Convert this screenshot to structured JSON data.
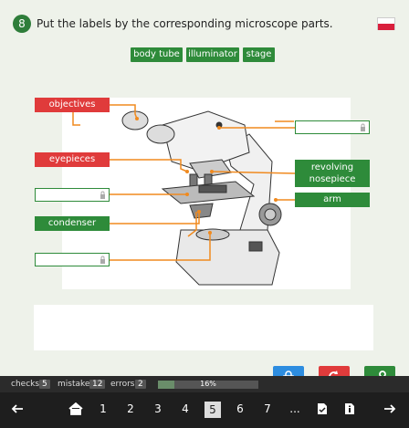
{
  "question": {
    "number": "8",
    "text": "Put the labels by the corresponding microscope parts."
  },
  "bank": [
    "body tube",
    "illuminator",
    "stage"
  ],
  "labels": {
    "objectives": "objectives",
    "eyepieces": "eyepieces",
    "condenser": "condenser",
    "revolving_nosepiece": "revolving nosepiece",
    "arm": "arm"
  },
  "colors": {
    "accent": "#2e8b3a",
    "wrong": "#e03b3b",
    "lock_btn": "#2d8de0",
    "retry_btn": "#e03b3b",
    "tools_btn": "#2e8b3a"
  },
  "icons": [
    "lock-icon",
    "retry-icon",
    "wrench-icon",
    "flag-icon"
  ],
  "status": {
    "checks_label": "checks",
    "checks": "5",
    "mistakes_label": "mistakes",
    "mistakes": "12",
    "errors_label": "errors",
    "errors": "2",
    "progress_text": "16%",
    "progress": 0.16
  },
  "nav": {
    "pages": [
      "1",
      "2",
      "3",
      "4",
      "5",
      "6",
      "7",
      "..."
    ],
    "active": "5"
  }
}
